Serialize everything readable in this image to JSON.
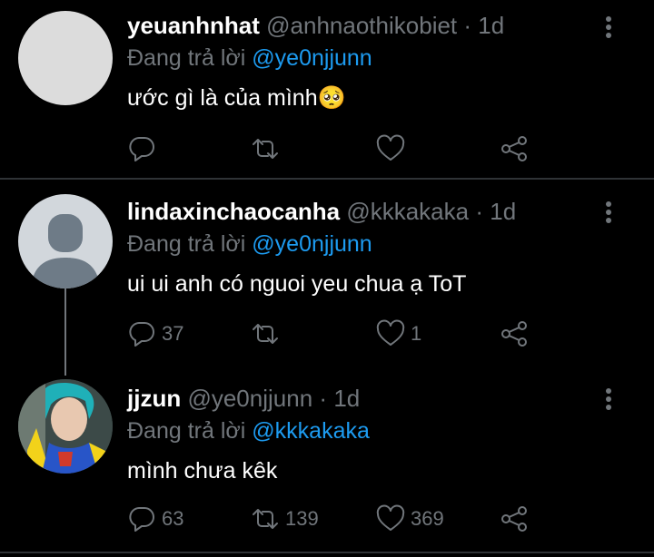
{
  "tweets": [
    {
      "name": "yeuanhnhat",
      "handle": "@anhnaothikobiet",
      "dot": "·",
      "time": "1d",
      "replying_prefix": "Đang trả lời",
      "replying_to": "@ye0njjunn",
      "text": "ước gì là của mình🥺",
      "avatar": "blank-avatar",
      "replies": "",
      "retweets": "",
      "likes": ""
    },
    {
      "name": "lindaxinchaocanha",
      "handle": "@kkkakaka",
      "dot": "·",
      "time": "1d",
      "replying_prefix": "Đang trả lời",
      "replying_to": "@ye0njjunn",
      "text": "ui ui anh có nguoi yeu chua ạ ToT",
      "avatar": "default-avatar",
      "replies": "37",
      "retweets": "",
      "likes": "1"
    },
    {
      "name": "jjzun",
      "handle": "@ye0njjunn",
      "dot": "·",
      "time": "1d",
      "replying_prefix": "Đang trả lời",
      "replying_to": "@kkkakaka",
      "text": "mình chưa kêk",
      "avatar": "photo-avatar",
      "replies": "63",
      "retweets": "139",
      "likes": "369"
    }
  ],
  "colors": {
    "background": "#000000",
    "text": "#ffffff",
    "muted": "#71767b",
    "accent": "#1d9bf0",
    "divider": "#2f3336"
  },
  "icons": [
    "reply-icon",
    "retweet-icon",
    "like-icon",
    "share-icon",
    "more-icon"
  ]
}
